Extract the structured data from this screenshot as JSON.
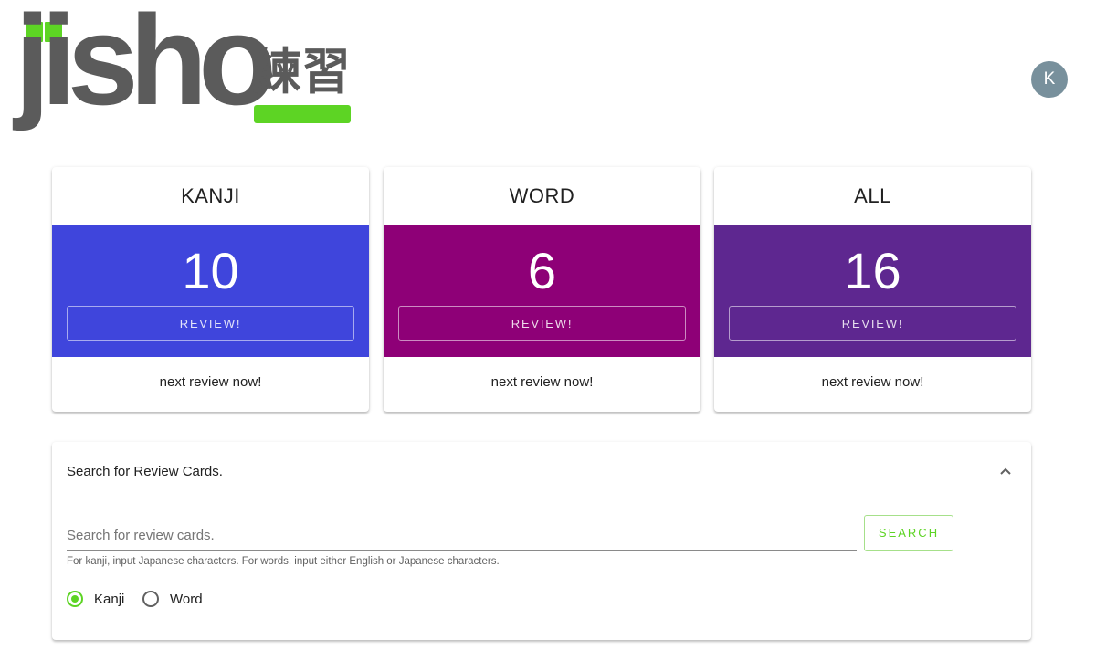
{
  "header": {
    "logo_text": "jisho",
    "logo_kanji": "練習",
    "avatar_initial": "K"
  },
  "cards": [
    {
      "title": "KANJI",
      "count": "10",
      "button": "REVIEW!",
      "next": "next review now!",
      "color": "#3f45dc"
    },
    {
      "title": "WORD",
      "count": "6",
      "button": "REVIEW!",
      "next": "next review now!",
      "color": "#8e0077"
    },
    {
      "title": "ALL",
      "count": "16",
      "button": "REVIEW!",
      "next": "next review now!",
      "color": "#5e2790"
    }
  ],
  "search": {
    "panel_title": "Search for Review Cards.",
    "input_value": "",
    "placeholder": "Search for review cards.",
    "hint": "For kanji, input Japanese characters. For words, input either English or Japanese characters.",
    "button": "SEARCH",
    "options": [
      {
        "label": "Kanji",
        "checked": true
      },
      {
        "label": "Word",
        "checked": false
      }
    ]
  },
  "colors": {
    "accent": "#5dd424",
    "logo_gray": "#5b5b5b",
    "avatar": "#78909c"
  }
}
